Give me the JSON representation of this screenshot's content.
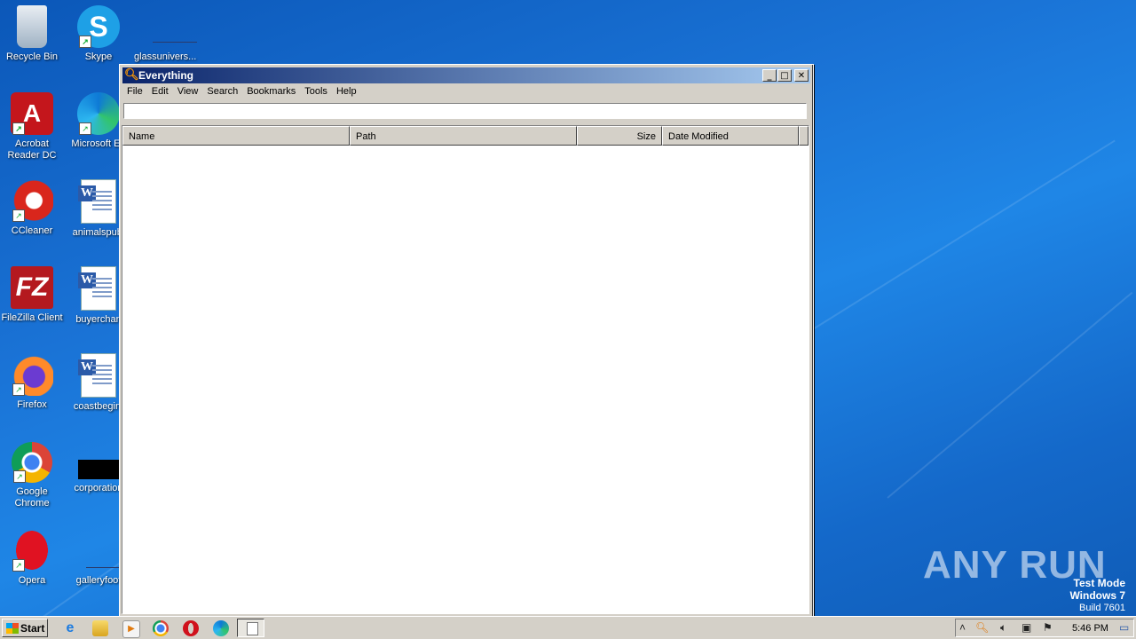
{
  "desktop": {
    "icons": [
      {
        "label": "Recycle Bin",
        "icon": "recycle-bin-icon"
      },
      {
        "label": "Skype",
        "icon": "skype-icon"
      },
      {
        "label": "glassunivers...",
        "icon": "file-icon"
      },
      {
        "label": "Acrobat Reader DC",
        "icon": "acrobat-icon"
      },
      {
        "label": "Microsoft Ed",
        "icon": "edge-icon"
      },
      {
        "label": "CCleaner",
        "icon": "ccleaner-icon"
      },
      {
        "label": "animalspubl",
        "icon": "word-doc-icon"
      },
      {
        "label": "FileZilla Client",
        "icon": "filezilla-icon"
      },
      {
        "label": "buyerchan",
        "icon": "word-doc-icon"
      },
      {
        "label": "Firefox",
        "icon": "firefox-icon"
      },
      {
        "label": "coastbegin.",
        "icon": "word-doc-icon"
      },
      {
        "label": "Google Chrome",
        "icon": "chrome-icon"
      },
      {
        "label": "corporation",
        "icon": "file-icon"
      },
      {
        "label": "Opera",
        "icon": "opera-icon"
      },
      {
        "label": "galleryfoot",
        "icon": "file-icon"
      }
    ]
  },
  "window": {
    "title": "Everything",
    "menu": [
      "File",
      "Edit",
      "View",
      "Search",
      "Bookmarks",
      "Tools",
      "Help"
    ],
    "search_value": "",
    "columns": [
      "Name",
      "Path",
      "Size",
      "Date Modified"
    ],
    "buttons": {
      "minimize": "_",
      "maximize": "□",
      "close": "✕"
    }
  },
  "taskbar": {
    "start_label": "Start",
    "clock": "5:46 PM"
  },
  "watermark": {
    "line1": "Test Mode",
    "line2": "Windows 7",
    "line3": "Build 7601",
    "brand": "ANY RUN"
  },
  "colors": {
    "title_gradient_start": "#0a246a",
    "title_gradient_end": "#a6caf0",
    "desktop_blue": "#1a73d6"
  }
}
